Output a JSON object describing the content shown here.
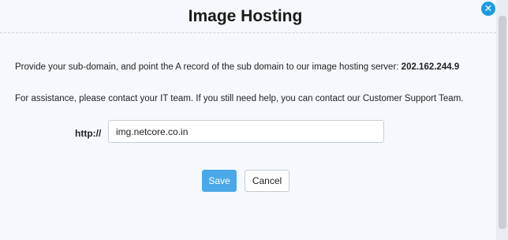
{
  "dialog": {
    "title": "Image Hosting",
    "close_icon_glyph": "✕",
    "instructions": {
      "text_before_ip": "Provide your sub-domain, and point the A record of the sub domain to our image hosting server: ",
      "server_ip": "202.162.244.9"
    },
    "assistance_text": "For assistance, please contact your IT team. If you still need help, you can contact our Customer Support Team.",
    "url_field": {
      "prefix_label": "http://",
      "value": "img.netcore.co.in"
    },
    "buttons": {
      "save_label": "Save",
      "cancel_label": "Cancel"
    }
  },
  "colors": {
    "accent": "#1a9be0",
    "save_button": "#4aa8e8",
    "dialog_background": "#f5f9fd"
  }
}
